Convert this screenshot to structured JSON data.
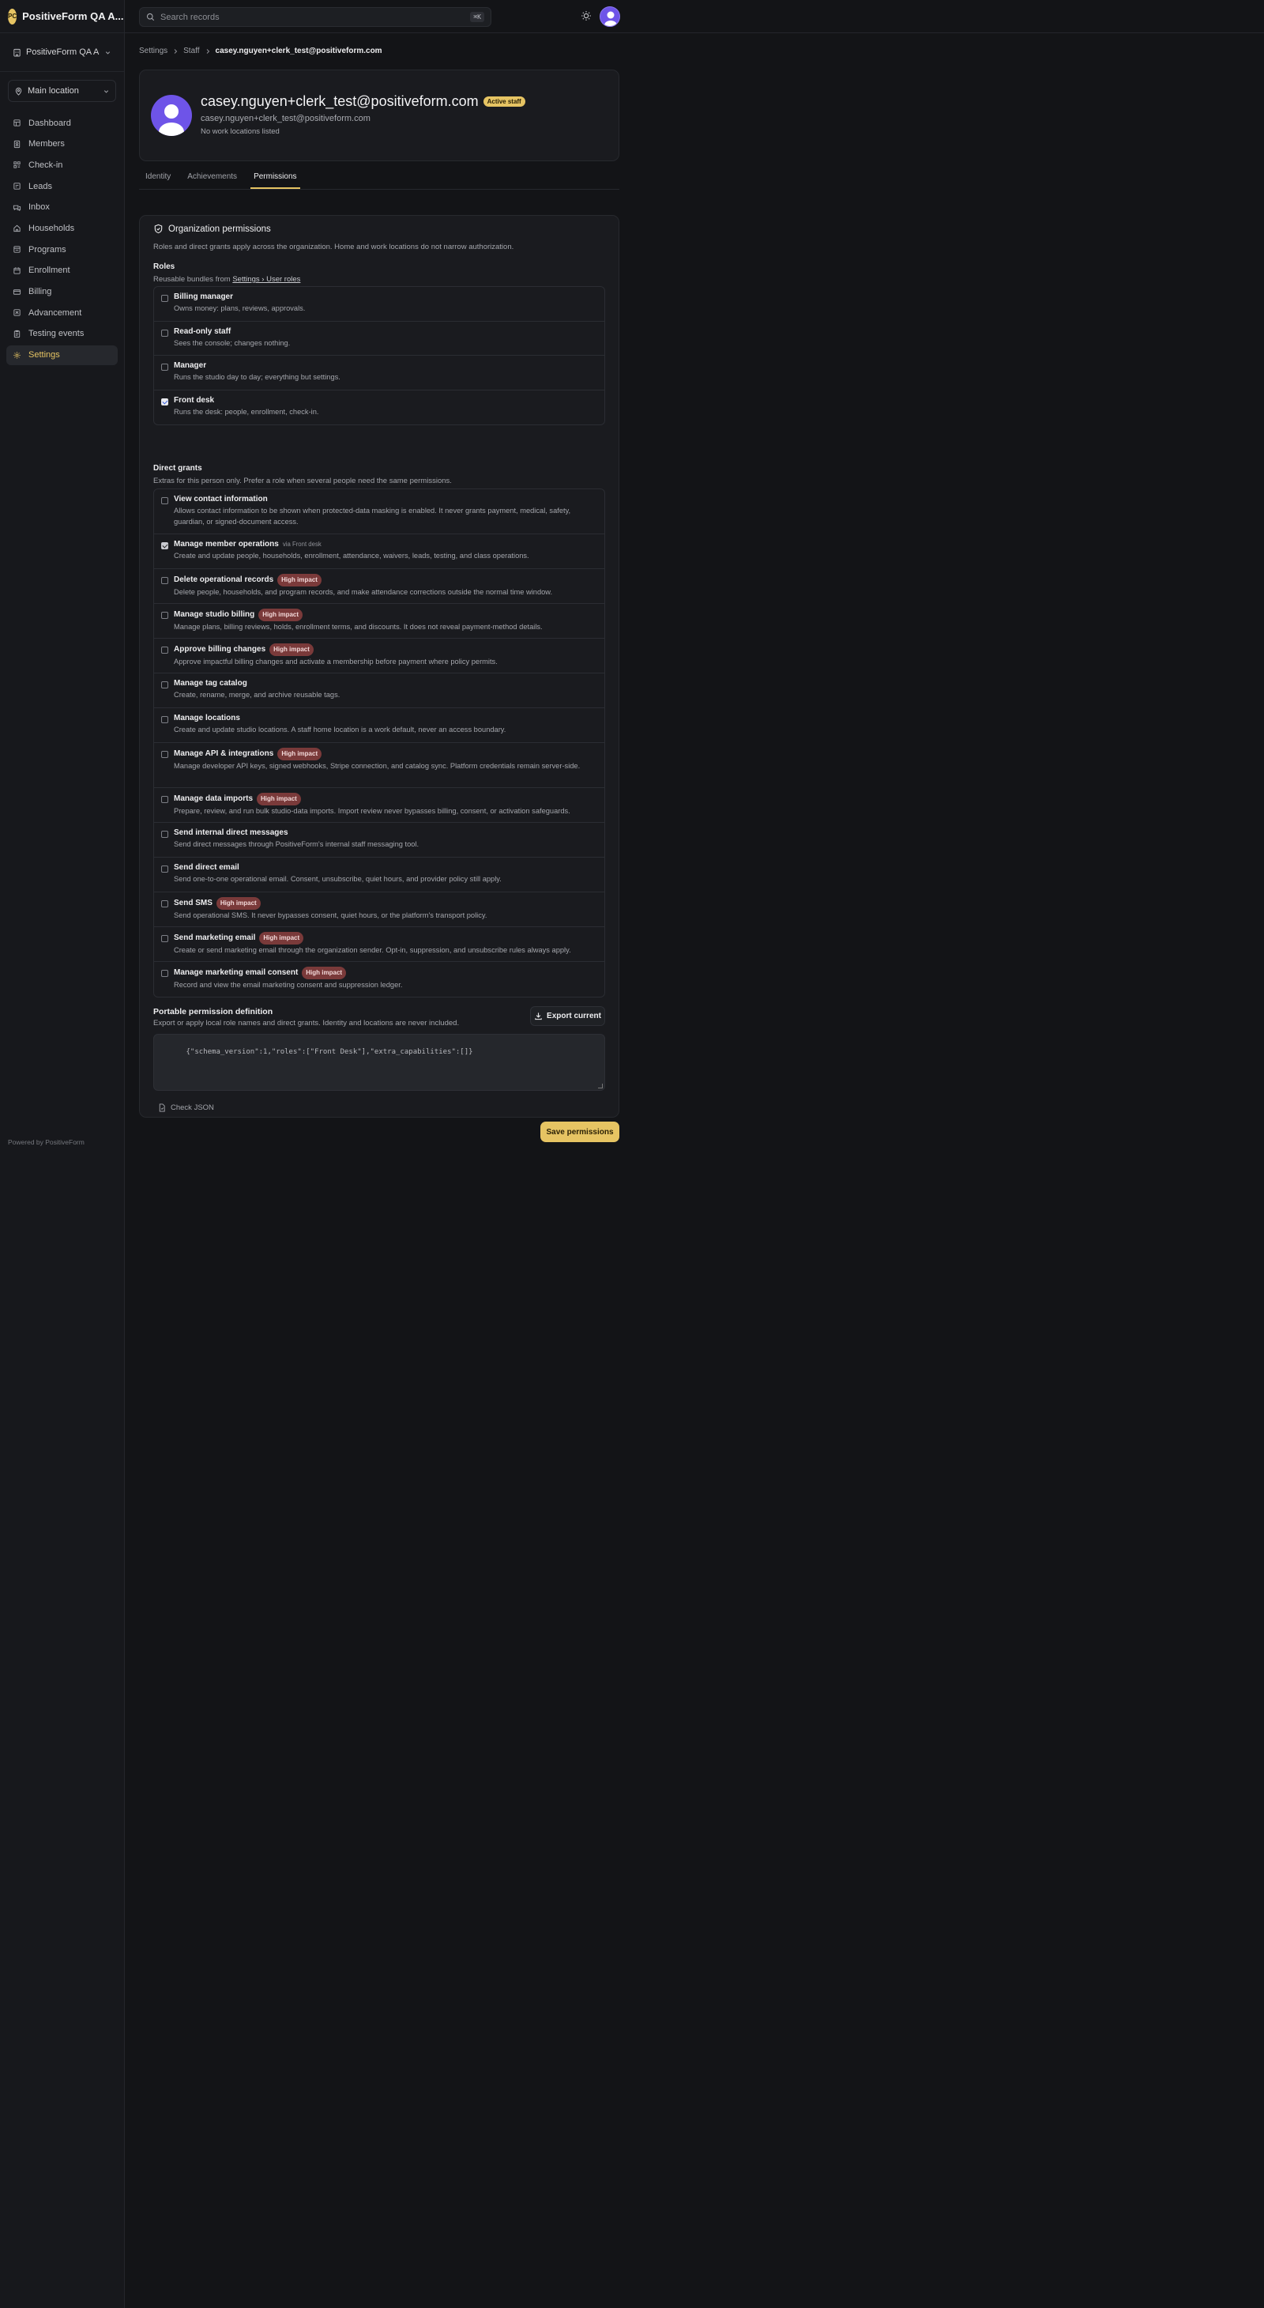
{
  "brand": {
    "initials": "PC",
    "name": "PositiveForm QA A..."
  },
  "org_switcher": {
    "label": "PositiveForm QA Au..."
  },
  "location": {
    "label": "Main location"
  },
  "nav": [
    {
      "label": "Dashboard",
      "icon": "dashboard-icon",
      "active": false
    },
    {
      "label": "Members",
      "icon": "members-icon",
      "active": false
    },
    {
      "label": "Check-in",
      "icon": "check-in-icon",
      "active": false
    },
    {
      "label": "Leads",
      "icon": "leads-icon",
      "active": false
    },
    {
      "label": "Inbox",
      "icon": "inbox-icon",
      "active": false
    },
    {
      "label": "Households",
      "icon": "home-icon",
      "active": false
    },
    {
      "label": "Programs",
      "icon": "programs-icon",
      "active": false
    },
    {
      "label": "Enrollment",
      "icon": "enrollment-icon",
      "active": false
    },
    {
      "label": "Billing",
      "icon": "billing-icon",
      "active": false
    },
    {
      "label": "Advancement",
      "icon": "advancement-icon",
      "active": false
    },
    {
      "label": "Testing events",
      "icon": "clipboard-icon",
      "active": false
    },
    {
      "label": "Settings",
      "icon": "gear-icon",
      "active": true
    }
  ],
  "footer": {
    "powered": "Powered by PositiveForm"
  },
  "search": {
    "placeholder": "Search records",
    "shortcut": "⌘K"
  },
  "breadcrumb": {
    "items": [
      "Settings",
      "Staff"
    ],
    "current": "casey.nguyen+clerk_test@positiveform.com"
  },
  "profile": {
    "name": "casey.nguyen+clerk_test@positiveform.com",
    "badge": "Active staff",
    "email": "casey.nguyen+clerk_test@positiveform.com",
    "locations": "No work locations listed"
  },
  "tabs": [
    {
      "label": "Identity",
      "active": false
    },
    {
      "label": "Achievements",
      "active": false
    },
    {
      "label": "Permissions",
      "active": true
    }
  ],
  "permissions": {
    "title": "Organization permissions",
    "subtitle": "Roles and direct grants apply across the organization. Home and work locations do not narrow authorization.",
    "roles_title": "Roles",
    "roles_sub_prefix": "Reusable bundles from",
    "roles_sub_link": "Settings › User roles",
    "roles": [
      {
        "name": "Billing manager",
        "desc": "Owns money: plans, reviews, approvals.",
        "checked": false
      },
      {
        "name": "Read-only staff",
        "desc": "Sees the console; changes nothing.",
        "checked": false
      },
      {
        "name": "Manager",
        "desc": "Runs the studio day to day; everything but settings.",
        "checked": false
      },
      {
        "name": "Front desk",
        "desc": "Runs the desk: people, enrollment, check-in.",
        "checked": true
      }
    ],
    "grants_title": "Direct grants",
    "grants_sub": "Extras for this person only. Prefer a role when several people need the same permissions.",
    "grants": [
      {
        "name": "View contact information",
        "desc": "Allows contact information to be shown when protected-data masking is enabled. It never grants payment, medical, safety, guardian, or signed-document access.",
        "checked": false,
        "badge": "",
        "via": ""
      },
      {
        "name": "Manage member operations",
        "desc": "Create and update people, households, enrollment, attendance, waivers, leads, testing, and class operations.",
        "checked": true,
        "badge": "",
        "via": "via Front desk"
      },
      {
        "name": "Delete operational records",
        "desc": "Delete people, households, and program records, and make attendance corrections outside the normal time window.",
        "checked": false,
        "badge": "High impact",
        "via": ""
      },
      {
        "name": "Manage studio billing",
        "desc": "Manage plans, billing reviews, holds, enrollment terms, and discounts. It does not reveal payment-method details.",
        "checked": false,
        "badge": "High impact",
        "via": ""
      },
      {
        "name": "Approve billing changes",
        "desc": "Approve impactful billing changes and activate a membership before payment where policy permits.",
        "checked": false,
        "badge": "High impact",
        "via": ""
      },
      {
        "name": "Manage tag catalog",
        "desc": "Create, rename, merge, and archive reusable tags.",
        "checked": false,
        "badge": "",
        "via": ""
      },
      {
        "name": "Manage locations",
        "desc": "Create and update studio locations. A staff home location is a work default, never an access boundary.",
        "checked": false,
        "badge": "",
        "via": ""
      },
      {
        "name": "Manage API & integrations",
        "desc": "Manage developer API keys, signed webhooks, Stripe connection, and catalog sync. Platform credentials remain server-side.",
        "checked": false,
        "badge": "High impact",
        "via": ""
      },
      {
        "name": "Manage data imports",
        "desc": "Prepare, review, and run bulk studio-data imports. Import review never bypasses billing, consent, or activation safeguards.",
        "checked": false,
        "badge": "High impact",
        "via": ""
      },
      {
        "name": "Send internal direct messages",
        "desc": "Send direct messages through PositiveForm's internal staff messaging tool.",
        "checked": false,
        "badge": "",
        "via": ""
      },
      {
        "name": "Send direct email",
        "desc": "Send one-to-one operational email. Consent, unsubscribe, quiet hours, and provider policy still apply.",
        "checked": false,
        "badge": "",
        "via": ""
      },
      {
        "name": "Send SMS",
        "desc": "Send operational SMS. It never bypasses consent, quiet hours, or the platform's transport policy.",
        "checked": false,
        "badge": "High impact",
        "via": ""
      },
      {
        "name": "Send marketing email",
        "desc": "Create or send marketing email through the organization sender. Opt-in, suppression, and unsubscribe rules always apply.",
        "checked": false,
        "badge": "High impact",
        "via": ""
      },
      {
        "name": "Manage marketing email consent",
        "desc": "Record and view the email marketing consent and suppression ledger.",
        "checked": false,
        "badge": "High impact",
        "via": ""
      }
    ],
    "portable_title": "Portable permission definition",
    "portable_sub": "Export or apply local role names and direct grants. Identity and locations are never included.",
    "export_label": "Export current",
    "json_value": "{\"schema_version\":1,\"roles\":[\"Front Desk\"],\"extra_capabilities\":[]}",
    "check_json_label": "Check JSON"
  },
  "save_label": "Save permissions",
  "colors": {
    "accent": "#e6c463",
    "background": "#131417",
    "avatar": "#6e54e8",
    "high_impact": "#7a3a3a"
  }
}
